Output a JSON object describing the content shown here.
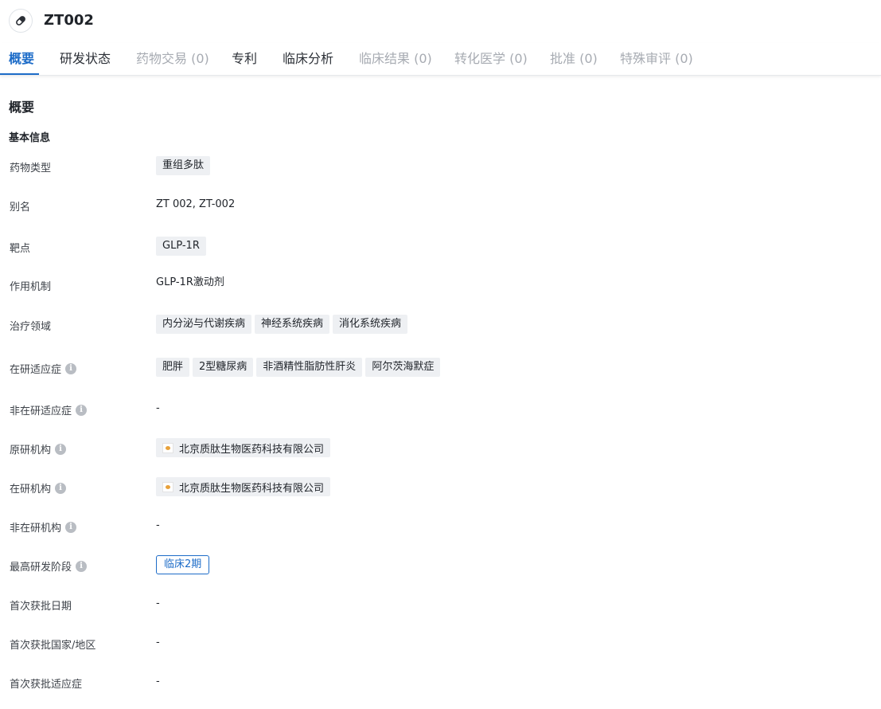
{
  "header": {
    "icon": "pill-icon",
    "title": "ZT002"
  },
  "tabs": [
    {
      "label": "概要",
      "state": "active"
    },
    {
      "label": "研发状态",
      "state": "enabled"
    },
    {
      "label": "药物交易 (0)",
      "state": "disabled"
    },
    {
      "label": "专利",
      "state": "enabled"
    },
    {
      "label": "临床分析",
      "state": "enabled"
    },
    {
      "label": "临床结果 (0)",
      "state": "disabled"
    },
    {
      "label": "转化医学 (0)",
      "state": "disabled"
    },
    {
      "label": "批准 (0)",
      "state": "disabled"
    },
    {
      "label": "特殊审评 (0)",
      "state": "disabled"
    }
  ],
  "section_title": "概要",
  "subsection_title": "基本信息",
  "fields": {
    "drug_type": {
      "label": "药物类型",
      "tags": [
        "重组多肽"
      ]
    },
    "alias": {
      "label": "别名",
      "value": "ZT 002,  ZT-002"
    },
    "target": {
      "label": "靶点",
      "tags": [
        "GLP-1R"
      ]
    },
    "mechanism": {
      "label": "作用机制",
      "value": "GLP-1R激动剂"
    },
    "therapeutic_area": {
      "label": "治疗领域",
      "tags": [
        "内分泌与代谢疾病",
        "神经系统疾病",
        "消化系统疾病"
      ]
    },
    "active_indication": {
      "label": "在研适应症",
      "tags": [
        "肥胖",
        "2型糖尿病",
        "非酒精性脂肪性肝炎",
        "阿尔茨海默症"
      ]
    },
    "inactive_indication": {
      "label": "非在研适应症",
      "value": "-"
    },
    "originator": {
      "label": "原研机构",
      "org": "北京质肽生物医药科技有限公司"
    },
    "active_org": {
      "label": "在研机构",
      "org": "北京质肽生物医药科技有限公司"
    },
    "inactive_org": {
      "label": "非在研机构",
      "value": "-"
    },
    "highest_phase": {
      "label": "最高研发阶段",
      "phase": "临床2期"
    },
    "first_approval_date": {
      "label": "首次获批日期",
      "value": "-"
    },
    "first_approval_country": {
      "label": "首次获批国家/地区",
      "value": "-"
    },
    "first_approval_indication": {
      "label": "首次获批适应症",
      "value": "-"
    }
  },
  "colors": {
    "accent": "#1d6cc8",
    "tag_bg": "#eef0f3",
    "disabled_tab": "#a7abb2"
  }
}
